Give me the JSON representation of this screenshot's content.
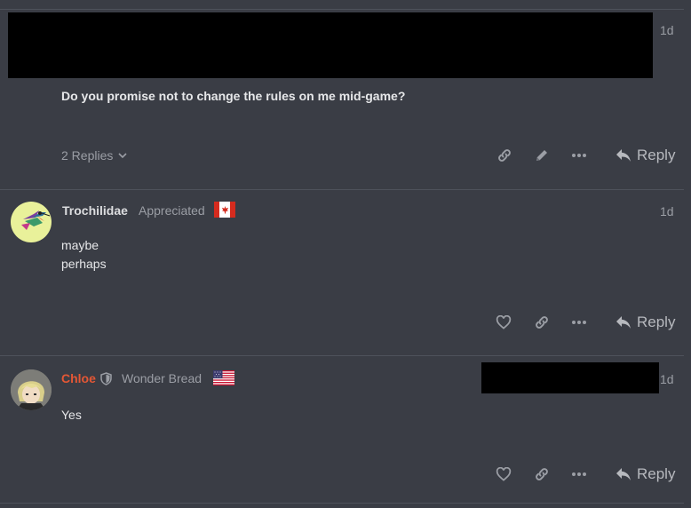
{
  "posts": [
    {
      "age": "1d",
      "body": "Do you promise not to change the rules on me mid-game?",
      "replies_label": "2 Replies",
      "reply_label": "Reply"
    },
    {
      "username": "Trochilidae",
      "user_title": "Appreciated",
      "flag": "Canada",
      "age": "1d",
      "body_lines": [
        "maybe",
        "perhaps"
      ],
      "reply_label": "Reply"
    },
    {
      "username": "Chloe",
      "username_color": "#e45735",
      "user_title": "Wonder Bread",
      "flag": "United States",
      "age": "1d",
      "body": "Yes",
      "reply_label": "Reply"
    }
  ],
  "colors": {
    "background": "#3a3d45",
    "redaction": "#000000",
    "icon": "#9b9ea5"
  }
}
